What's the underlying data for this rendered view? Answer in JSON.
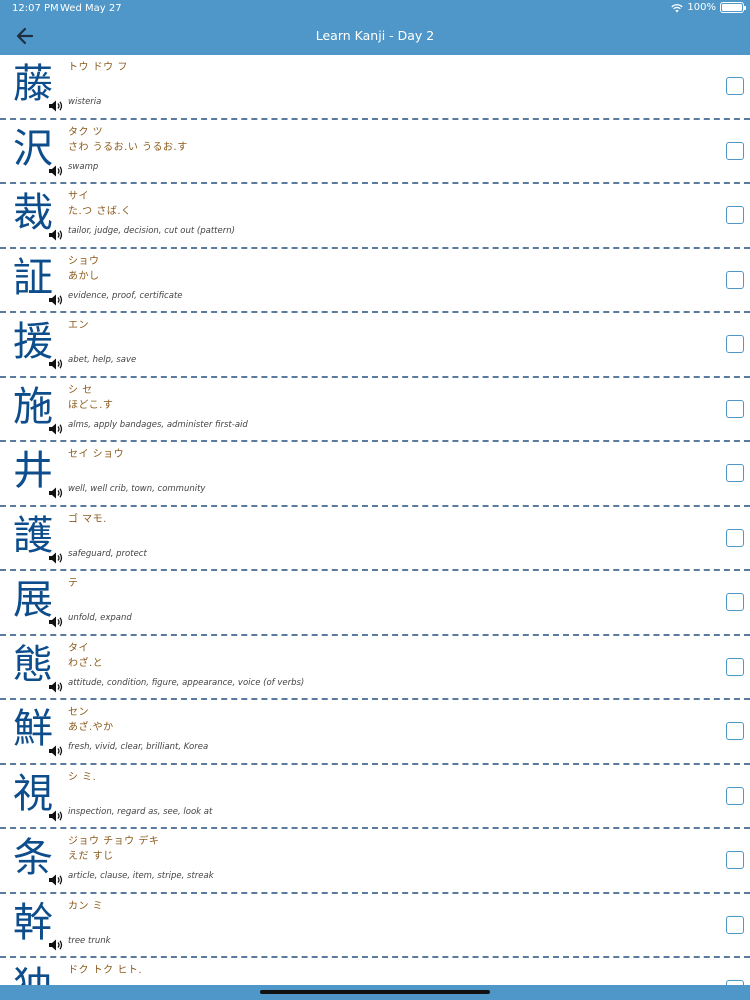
{
  "status_bar": {
    "time": "12:07 PM",
    "date": "Wed May 27",
    "battery": "100%"
  },
  "header": {
    "title": "Learn Kanji - Day 2",
    "back_icon": "arrow-left-icon"
  },
  "colors": {
    "header": "#4f97c9",
    "kanji": "#0e4d8c",
    "reading": "#8b5a1c",
    "divider": "#5a7a9e"
  },
  "kanji_list": [
    {
      "kanji": "藤",
      "on": "トウ ドウ フ",
      "kun": "",
      "meaning": "wisteria",
      "checked": false
    },
    {
      "kanji": "沢",
      "on": "タク ツ",
      "kun": "さわ うるお.い うるお.す",
      "meaning": "swamp",
      "checked": false
    },
    {
      "kanji": "裁",
      "on": "サイ",
      "kun": "た.つ さば.く",
      "meaning": "tailor, judge, decision, cut out (pattern)",
      "checked": false
    },
    {
      "kanji": "証",
      "on": "ショウ",
      "kun": "あかし",
      "meaning": "evidence, proof, certificate",
      "checked": false
    },
    {
      "kanji": "援",
      "on": "エン",
      "kun": "",
      "meaning": "abet, help, save",
      "checked": false
    },
    {
      "kanji": "施",
      "on": "シ セ",
      "kun": "ほどこ.す",
      "meaning": "alms, apply bandages, administer first-aid",
      "checked": false
    },
    {
      "kanji": "井",
      "on": "セイ ショウ",
      "kun": "",
      "meaning": "well, well crib, town, community",
      "checked": false
    },
    {
      "kanji": "護",
      "on": "ゴ マモ.",
      "kun": "",
      "meaning": "safeguard, protect",
      "checked": false
    },
    {
      "kanji": "展",
      "on": "テ",
      "kun": "",
      "meaning": "unfold, expand",
      "checked": false
    },
    {
      "kanji": "態",
      "on": "タイ",
      "kun": "わざ.と",
      "meaning": "attitude, condition, figure, appearance, voice (of verbs)",
      "checked": false
    },
    {
      "kanji": "鮮",
      "on": "セン",
      "kun": "あざ.やか",
      "meaning": "fresh, vivid, clear, brilliant, Korea",
      "checked": false
    },
    {
      "kanji": "視",
      "on": "シ ミ.",
      "kun": "",
      "meaning": "inspection, regard as, see, look at",
      "checked": false
    },
    {
      "kanji": "条",
      "on": "ジョウ チョウ デキ",
      "kun": "えだ すじ",
      "meaning": "article, clause, item, stripe, streak",
      "checked": false
    },
    {
      "kanji": "幹",
      "on": "カン ミ",
      "kun": "",
      "meaning": "tree trunk",
      "checked": false
    },
    {
      "kanji": "独",
      "on": "ドク トク ヒト.",
      "kun": "",
      "meaning": "",
      "checked": false
    }
  ]
}
